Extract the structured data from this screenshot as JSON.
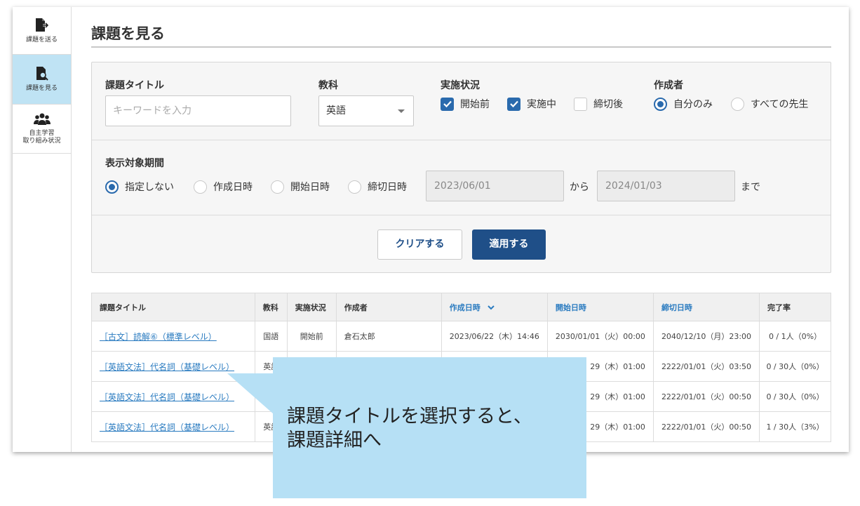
{
  "sidebar": {
    "items": [
      {
        "label": "課題を送る",
        "icon": "send-file-icon",
        "active": false
      },
      {
        "label": "課題を見る",
        "icon": "search-file-icon",
        "active": true
      },
      {
        "label": "自主学習\n取り組み状況",
        "icon": "users-icon",
        "active": false
      }
    ]
  },
  "header": {
    "title": "課題を見る"
  },
  "filters": {
    "title_label": "課題タイトル",
    "title_placeholder": "キーワードを入力",
    "subject_label": "教科",
    "subject_value": "英語",
    "status_label": "実施状況",
    "status_options": [
      {
        "label": "開始前",
        "checked": true
      },
      {
        "label": "実施中",
        "checked": true
      },
      {
        "label": "締切後",
        "checked": false
      }
    ],
    "author_label": "作成者",
    "author_options": [
      {
        "label": "自分のみ",
        "selected": true
      },
      {
        "label": "すべての先生",
        "selected": false
      }
    ],
    "period_label": "表示対象期間",
    "period_options": [
      {
        "label": "指定しない",
        "selected": true
      },
      {
        "label": "作成日時",
        "selected": false
      },
      {
        "label": "開始日時",
        "selected": false
      },
      {
        "label": "締切日時",
        "selected": false
      }
    ],
    "date_from": "2023/06/01",
    "from_word": "から",
    "date_to": "2024/01/03",
    "to_word": "まで",
    "clear_label": "クリアする",
    "apply_label": "適用する"
  },
  "table": {
    "headers": [
      "課題タイトル",
      "教科",
      "実施状況",
      "作成者",
      "作成日時",
      "開始日時",
      "締切日時",
      "完了率"
    ],
    "rows": [
      {
        "title": "［古文］読解⑥（標準レベル）",
        "subject": "国語",
        "status": "開始前",
        "author": "倉石太郎",
        "created": "2023/06/22（木）14:46",
        "start": "2030/01/01（火）00:00",
        "end": "2040/12/10（月）23:00",
        "rate": "0 / 1人（0%）"
      },
      {
        "title": "［英語文法］代名詞（基礎レベル）",
        "subject": "英語",
        "status": "",
        "author": "",
        "created": "",
        "start": "29（木）01:00",
        "end": "2222/01/01（火）03:50",
        "rate": "0 / 30人（0%）"
      },
      {
        "title": "［英語文法］代名詞（基礎レベル）",
        "subject": "",
        "status": "",
        "author": "",
        "created": "",
        "start": "29（木）01:00",
        "end": "2222/01/01（火）00:50",
        "rate": "0 / 30人（0%）"
      },
      {
        "title": "［英語文法］代名詞（基礎レベル）",
        "subject": "英語",
        "status": "",
        "author": "",
        "created": "",
        "start": "29（木）01:00",
        "end": "2222/01/01（火）00:50",
        "rate": "1 / 30人（3%）"
      }
    ]
  },
  "callout": {
    "text_line1": "課題タイトルを選択すると、",
    "text_line2": "課題詳細へ"
  },
  "colors": {
    "accent": "#1f4f88",
    "link": "#2a7bc0",
    "active_nav": "#bfe3f4",
    "callout": "#b6e0f5"
  }
}
